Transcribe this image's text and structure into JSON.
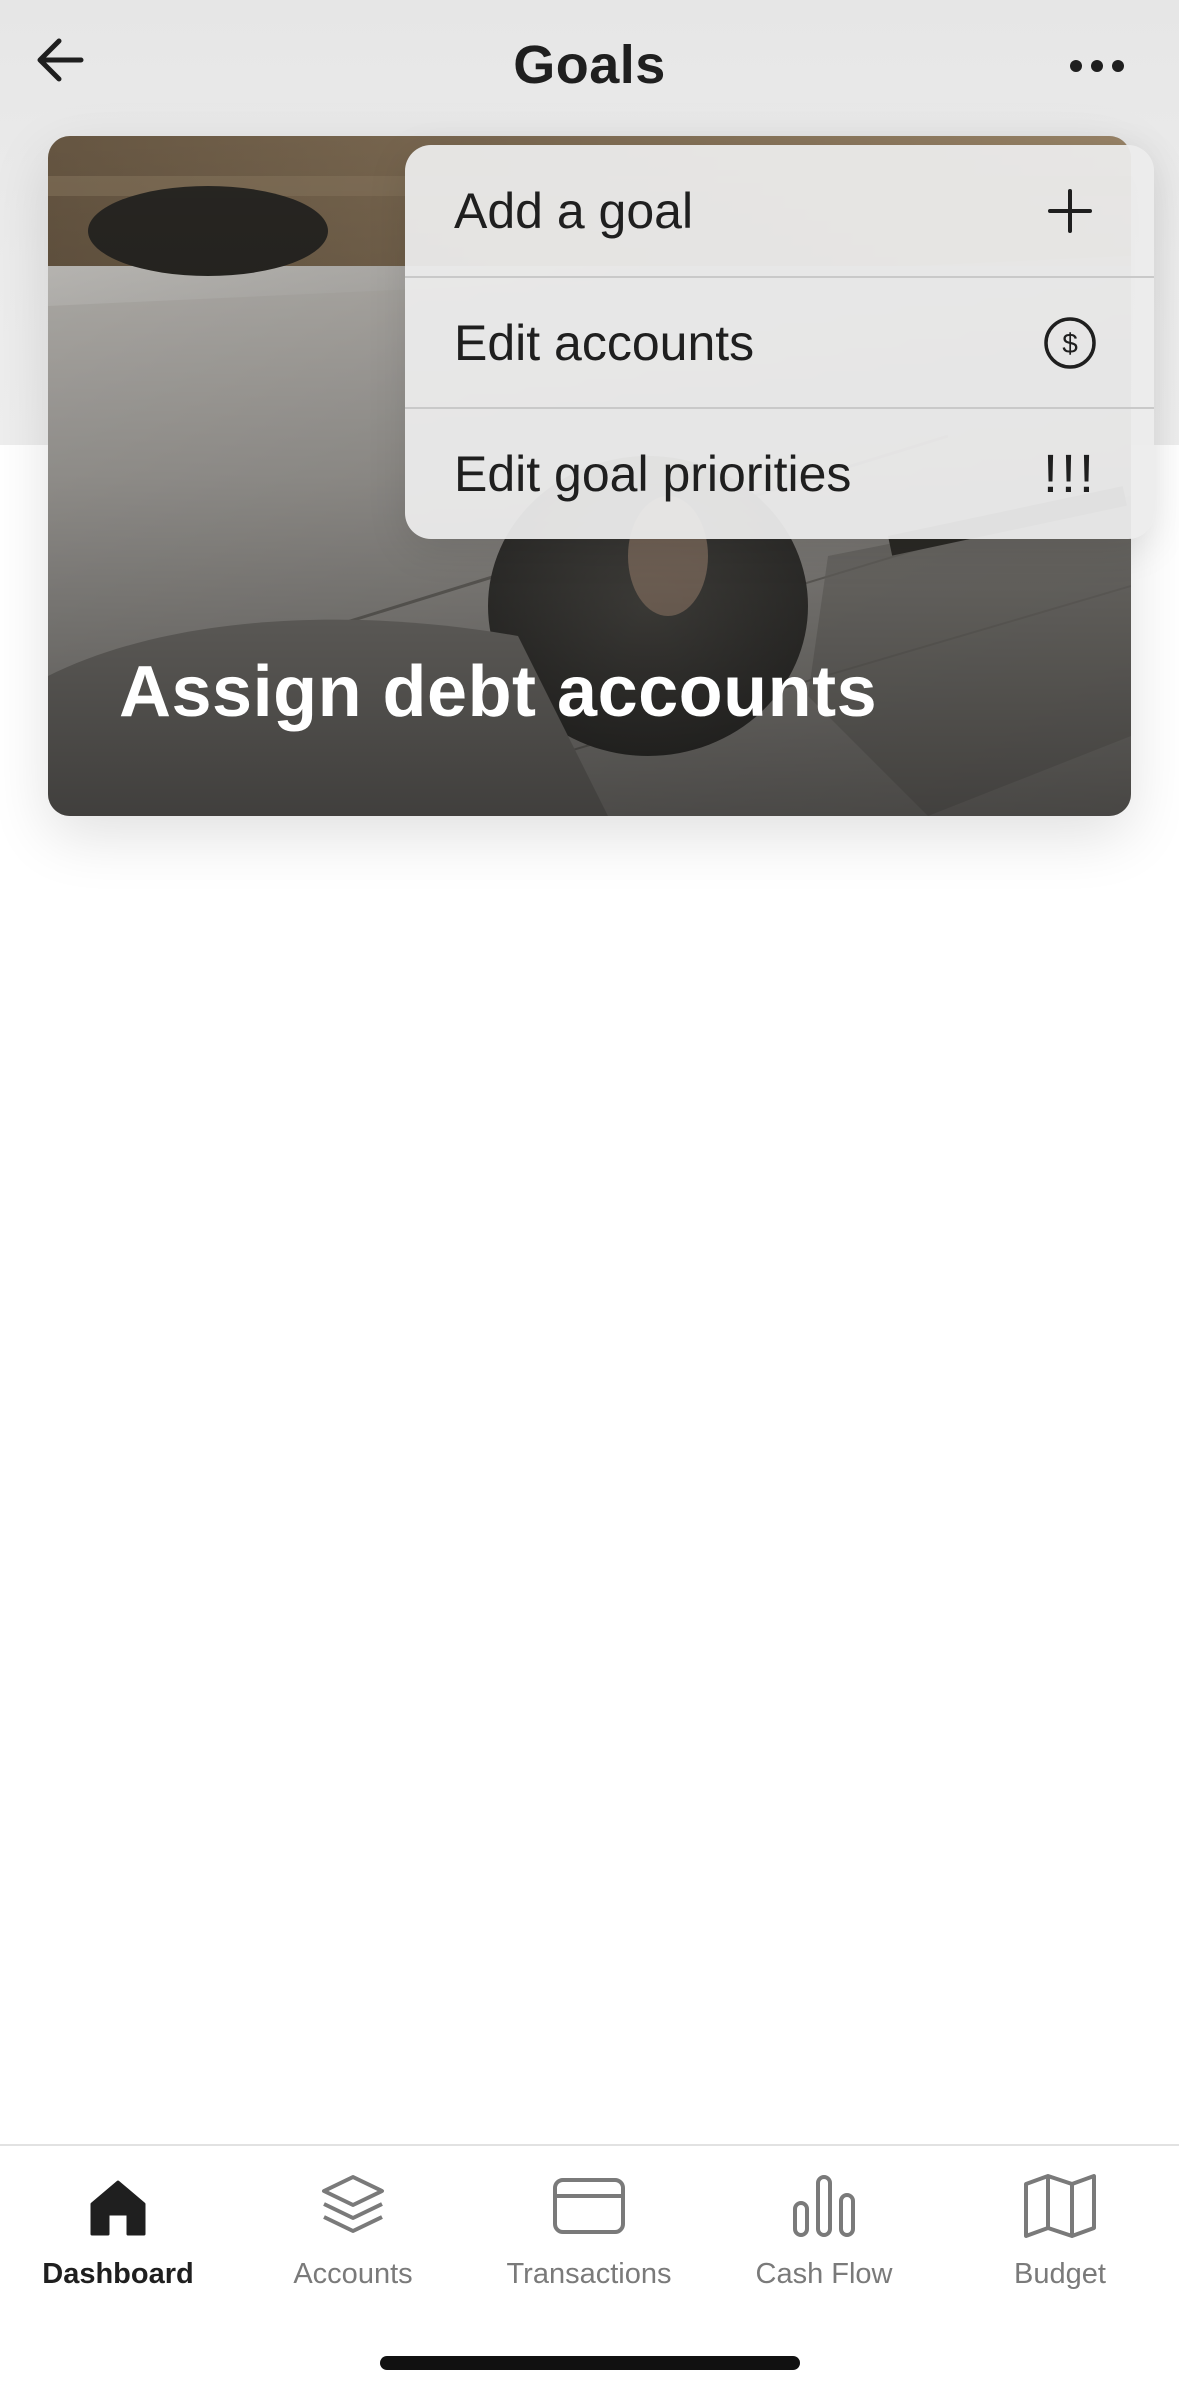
{
  "header": {
    "title": "Goals",
    "back_icon": "arrow-left-icon",
    "more_icon": "ellipsis-icon"
  },
  "goal_card": {
    "title": "Assign debt accounts"
  },
  "menu": {
    "items": [
      {
        "label": "Add a goal",
        "icon": "plus-icon"
      },
      {
        "label": "Edit accounts",
        "icon": "dollar-circle-icon"
      },
      {
        "label": "Edit goal priorities",
        "icon": "priority-icon",
        "icon_text": "!!!"
      }
    ]
  },
  "tabbar": {
    "active": "Dashboard",
    "tabs": [
      {
        "label": "Dashboard",
        "icon": "home-icon"
      },
      {
        "label": "Accounts",
        "icon": "layers-icon"
      },
      {
        "label": "Transactions",
        "icon": "credit-card-icon"
      },
      {
        "label": "Cash Flow",
        "icon": "bar-chart-icon"
      },
      {
        "label": "Budget",
        "icon": "map-icon"
      }
    ]
  },
  "colors": {
    "text_primary": "#1f1f1f",
    "tab_inactive": "#7a7a7a",
    "menu_bg": "#ececec"
  }
}
